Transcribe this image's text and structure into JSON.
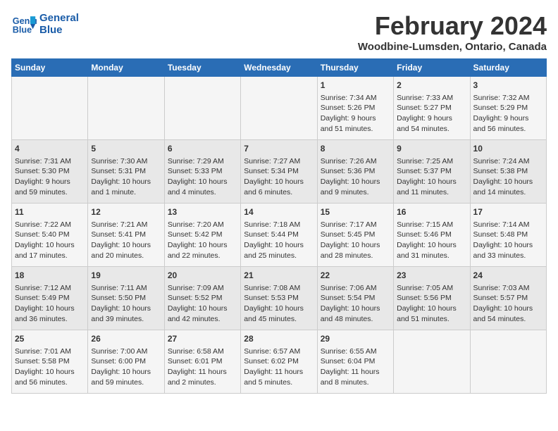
{
  "header": {
    "logo_line1": "General",
    "logo_line2": "Blue",
    "title": "February 2024",
    "subtitle": "Woodbine-Lumsden, Ontario, Canada"
  },
  "days_of_week": [
    "Sunday",
    "Monday",
    "Tuesday",
    "Wednesday",
    "Thursday",
    "Friday",
    "Saturday"
  ],
  "weeks": [
    [
      {
        "day": "",
        "info": ""
      },
      {
        "day": "",
        "info": ""
      },
      {
        "day": "",
        "info": ""
      },
      {
        "day": "",
        "info": ""
      },
      {
        "day": "1",
        "info": "Sunrise: 7:34 AM\nSunset: 5:26 PM\nDaylight: 9 hours\nand 51 minutes."
      },
      {
        "day": "2",
        "info": "Sunrise: 7:33 AM\nSunset: 5:27 PM\nDaylight: 9 hours\nand 54 minutes."
      },
      {
        "day": "3",
        "info": "Sunrise: 7:32 AM\nSunset: 5:29 PM\nDaylight: 9 hours\nand 56 minutes."
      }
    ],
    [
      {
        "day": "4",
        "info": "Sunrise: 7:31 AM\nSunset: 5:30 PM\nDaylight: 9 hours\nand 59 minutes."
      },
      {
        "day": "5",
        "info": "Sunrise: 7:30 AM\nSunset: 5:31 PM\nDaylight: 10 hours\nand 1 minute."
      },
      {
        "day": "6",
        "info": "Sunrise: 7:29 AM\nSunset: 5:33 PM\nDaylight: 10 hours\nand 4 minutes."
      },
      {
        "day": "7",
        "info": "Sunrise: 7:27 AM\nSunset: 5:34 PM\nDaylight: 10 hours\nand 6 minutes."
      },
      {
        "day": "8",
        "info": "Sunrise: 7:26 AM\nSunset: 5:36 PM\nDaylight: 10 hours\nand 9 minutes."
      },
      {
        "day": "9",
        "info": "Sunrise: 7:25 AM\nSunset: 5:37 PM\nDaylight: 10 hours\nand 11 minutes."
      },
      {
        "day": "10",
        "info": "Sunrise: 7:24 AM\nSunset: 5:38 PM\nDaylight: 10 hours\nand 14 minutes."
      }
    ],
    [
      {
        "day": "11",
        "info": "Sunrise: 7:22 AM\nSunset: 5:40 PM\nDaylight: 10 hours\nand 17 minutes."
      },
      {
        "day": "12",
        "info": "Sunrise: 7:21 AM\nSunset: 5:41 PM\nDaylight: 10 hours\nand 20 minutes."
      },
      {
        "day": "13",
        "info": "Sunrise: 7:20 AM\nSunset: 5:42 PM\nDaylight: 10 hours\nand 22 minutes."
      },
      {
        "day": "14",
        "info": "Sunrise: 7:18 AM\nSunset: 5:44 PM\nDaylight: 10 hours\nand 25 minutes."
      },
      {
        "day": "15",
        "info": "Sunrise: 7:17 AM\nSunset: 5:45 PM\nDaylight: 10 hours\nand 28 minutes."
      },
      {
        "day": "16",
        "info": "Sunrise: 7:15 AM\nSunset: 5:46 PM\nDaylight: 10 hours\nand 31 minutes."
      },
      {
        "day": "17",
        "info": "Sunrise: 7:14 AM\nSunset: 5:48 PM\nDaylight: 10 hours\nand 33 minutes."
      }
    ],
    [
      {
        "day": "18",
        "info": "Sunrise: 7:12 AM\nSunset: 5:49 PM\nDaylight: 10 hours\nand 36 minutes."
      },
      {
        "day": "19",
        "info": "Sunrise: 7:11 AM\nSunset: 5:50 PM\nDaylight: 10 hours\nand 39 minutes."
      },
      {
        "day": "20",
        "info": "Sunrise: 7:09 AM\nSunset: 5:52 PM\nDaylight: 10 hours\nand 42 minutes."
      },
      {
        "day": "21",
        "info": "Sunrise: 7:08 AM\nSunset: 5:53 PM\nDaylight: 10 hours\nand 45 minutes."
      },
      {
        "day": "22",
        "info": "Sunrise: 7:06 AM\nSunset: 5:54 PM\nDaylight: 10 hours\nand 48 minutes."
      },
      {
        "day": "23",
        "info": "Sunrise: 7:05 AM\nSunset: 5:56 PM\nDaylight: 10 hours\nand 51 minutes."
      },
      {
        "day": "24",
        "info": "Sunrise: 7:03 AM\nSunset: 5:57 PM\nDaylight: 10 hours\nand 54 minutes."
      }
    ],
    [
      {
        "day": "25",
        "info": "Sunrise: 7:01 AM\nSunset: 5:58 PM\nDaylight: 10 hours\nand 56 minutes."
      },
      {
        "day": "26",
        "info": "Sunrise: 7:00 AM\nSunset: 6:00 PM\nDaylight: 10 hours\nand 59 minutes."
      },
      {
        "day": "27",
        "info": "Sunrise: 6:58 AM\nSunset: 6:01 PM\nDaylight: 11 hours\nand 2 minutes."
      },
      {
        "day": "28",
        "info": "Sunrise: 6:57 AM\nSunset: 6:02 PM\nDaylight: 11 hours\nand 5 minutes."
      },
      {
        "day": "29",
        "info": "Sunrise: 6:55 AM\nSunset: 6:04 PM\nDaylight: 11 hours\nand 8 minutes."
      },
      {
        "day": "",
        "info": ""
      },
      {
        "day": "",
        "info": ""
      }
    ]
  ]
}
